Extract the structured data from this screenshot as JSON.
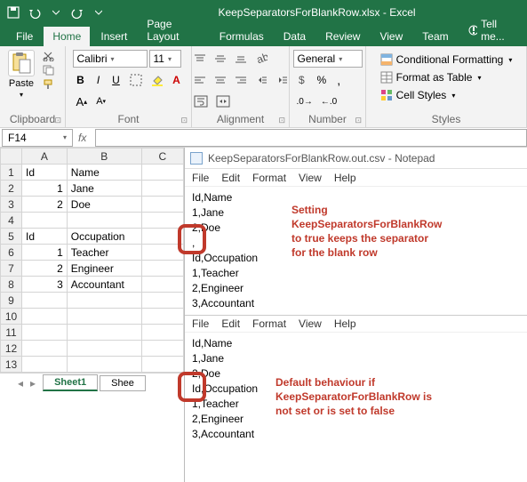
{
  "qat": {
    "save": "save",
    "undo": "undo",
    "redo": "redo"
  },
  "title": "KeepSeparatorsForBlankRow.xlsx - Excel",
  "tabs": {
    "file": "File",
    "home": "Home",
    "insert": "Insert",
    "pagelayout": "Page Layout",
    "formulas": "Formulas",
    "data": "Data",
    "review": "Review",
    "view": "View",
    "team": "Team",
    "tell": "Tell me..."
  },
  "ribbon": {
    "clipboard": {
      "label": "Clipboard",
      "paste": "Paste"
    },
    "font": {
      "label": "Font",
      "name": "Calibri",
      "size": "11",
      "bold": "B",
      "italic": "I",
      "underline": "U"
    },
    "alignment": {
      "label": "Alignment"
    },
    "number": {
      "label": "Number",
      "format": "General"
    },
    "styles": {
      "label": "Styles",
      "cond": "Conditional Formatting",
      "table": "Format as Table",
      "cell": "Cell Styles"
    }
  },
  "namebox": "F14",
  "sheet": {
    "cols": [
      "A",
      "B",
      "C"
    ],
    "rows": [
      {
        "n": "1",
        "c": [
          "Id",
          "Name",
          ""
        ]
      },
      {
        "n": "2",
        "c": [
          "1",
          "Jane",
          ""
        ]
      },
      {
        "n": "3",
        "c": [
          "2",
          "Doe",
          ""
        ]
      },
      {
        "n": "4",
        "c": [
          "",
          "",
          ""
        ]
      },
      {
        "n": "5",
        "c": [
          "Id",
          "Occupation",
          ""
        ]
      },
      {
        "n": "6",
        "c": [
          "1",
          "Teacher",
          ""
        ]
      },
      {
        "n": "7",
        "c": [
          "2",
          "Engineer",
          ""
        ]
      },
      {
        "n": "8",
        "c": [
          "3",
          "Accountant",
          ""
        ]
      },
      {
        "n": "9",
        "c": [
          "",
          "",
          ""
        ]
      },
      {
        "n": "10",
        "c": [
          "",
          "",
          ""
        ]
      },
      {
        "n": "11",
        "c": [
          "",
          "",
          ""
        ]
      },
      {
        "n": "12",
        "c": [
          "",
          "",
          ""
        ]
      },
      {
        "n": "13",
        "c": [
          "",
          "",
          ""
        ]
      }
    ],
    "tabs": {
      "s1": "Sheet1",
      "s2": "Shee"
    }
  },
  "notepad": {
    "title": "KeepSeparatorsForBlankRow.out.csv - Notepad",
    "menu": {
      "file": "File",
      "edit": "Edit",
      "format": "Format",
      "view": "View",
      "help": "Help"
    },
    "block1": [
      "Id,Name",
      "1,Jane",
      "2,Doe",
      ",",
      "Id,Occupation",
      "1,Teacher",
      "2,Engineer",
      "3,Accountant"
    ],
    "block2": [
      "Id,Name",
      "1,Jane",
      "2,Doe",
      "",
      "Id,Occupation",
      "1,Teacher",
      "2,Engineer",
      "3,Accountant"
    ]
  },
  "anno": {
    "a1l1": "Setting",
    "a1l2": "KeepSeparatorsForBlankRow",
    "a1l3": "to true keeps the separator",
    "a1l4": "for the blank row",
    "a2l1": "Default behaviour if",
    "a2l2": "KeepSeparatorForBlankRow is",
    "a2l3": "not set or is set to false"
  }
}
